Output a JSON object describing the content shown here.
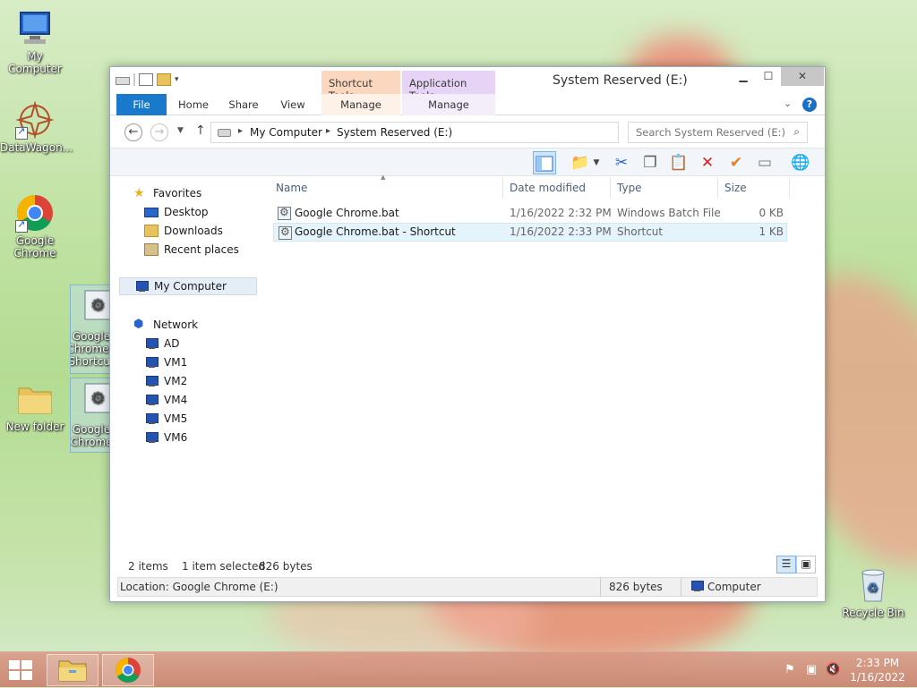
{
  "desktop": {
    "icons": [
      {
        "label": "My Computer"
      },
      {
        "label": "DataWagon..."
      },
      {
        "label": "Google Chrome"
      },
      {
        "label": "Google Chrome - Shortcut"
      },
      {
        "label": "Google Chrome"
      },
      {
        "label": "New folder"
      },
      {
        "label": "Recycle Bin"
      }
    ]
  },
  "window": {
    "title": "System Reserved (E:)",
    "context_tabs": {
      "shortcut_tools": "Shortcut Tools",
      "application_tools": "Application Tools"
    },
    "ribbon_tabs": {
      "file": "File",
      "home": "Home",
      "share": "Share",
      "view": "View",
      "manage1": "Manage",
      "manage2": "Manage"
    },
    "address": {
      "crumbs": [
        "My Computer",
        "System Reserved (E:)"
      ]
    },
    "search": {
      "placeholder": "Search System Reserved (E:)"
    },
    "nav": {
      "favorites": "Favorites",
      "favorites_items": [
        "Desktop",
        "Downloads",
        "Recent places"
      ],
      "my_computer": "My Computer",
      "network": "Network",
      "network_items": [
        "AD",
        "VM1",
        "VM2",
        "VM4",
        "VM5",
        "VM6"
      ]
    },
    "columns": {
      "name": "Name",
      "date": "Date modified",
      "type": "Type",
      "size": "Size"
    },
    "files": [
      {
        "name": "Google Chrome.bat",
        "date": "1/16/2022 2:32 PM",
        "type": "Windows Batch File",
        "size": "0 KB"
      },
      {
        "name": "Google Chrome.bat - Shortcut",
        "date": "1/16/2022 2:33 PM",
        "type": "Shortcut",
        "size": "1 KB"
      }
    ],
    "status": {
      "items": "2 items",
      "selected": "1 item selected",
      "bytes": "826 bytes"
    },
    "details": {
      "location": "Location: Google Chrome (E:)",
      "size": "826 bytes",
      "computer": "Computer"
    }
  },
  "taskbar": {
    "time": "2:33 PM",
    "date": "1/16/2022"
  },
  "colors": {
    "accent": "#1979ca",
    "shortcut_tools": "#fbd7c0",
    "application_tools": "#e6d3f6"
  }
}
